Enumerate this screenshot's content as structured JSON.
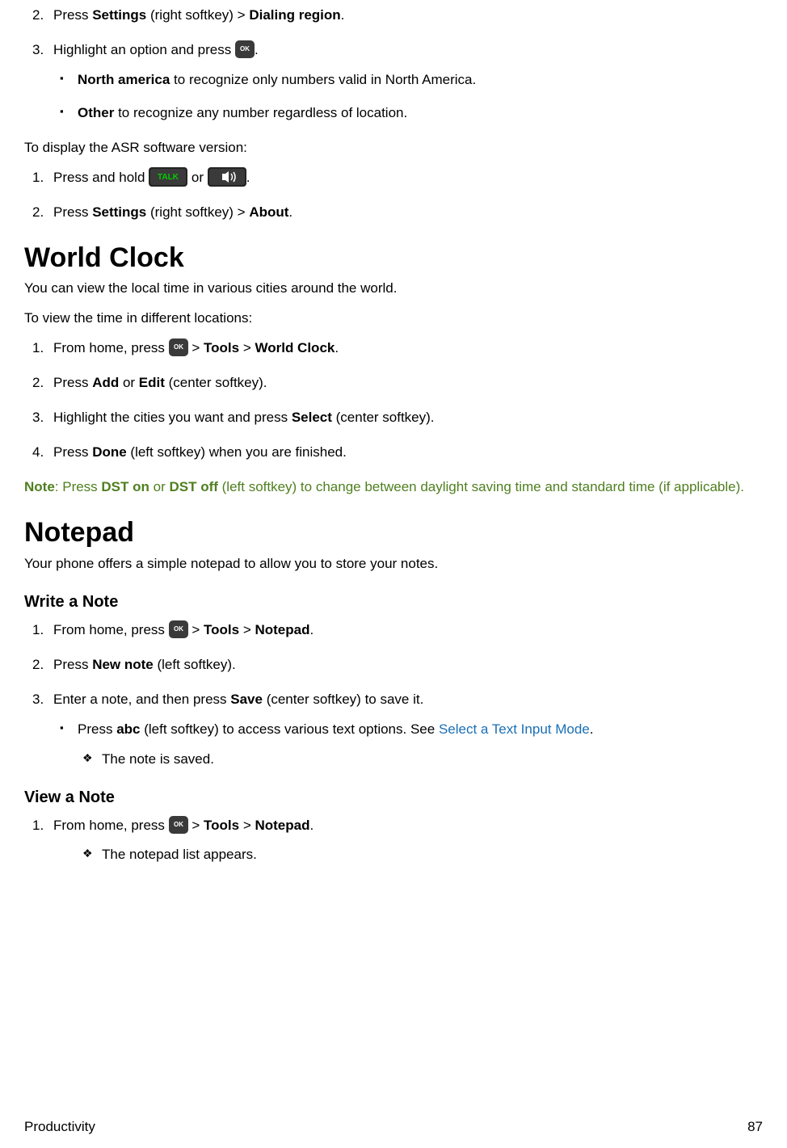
{
  "steps_top": {
    "s2_a": "Press ",
    "s2_b": "Settings",
    "s2_c": " (right softkey) > ",
    "s2_d": "Dialing region",
    "s2_e": ".",
    "s3_a": "Highlight an option and press ",
    "s3_b": ".",
    "bul1_a": "North america",
    "bul1_b": " to recognize only numbers valid in North America.",
    "bul2_a": "Other",
    "bul2_b": " to recognize any number regardless of location."
  },
  "asr": {
    "intro": "To display the ASR software version:",
    "s1_a": "Press and hold ",
    "s1_b": " or ",
    "s1_c": ".",
    "s2_a": "Press ",
    "s2_b": "Settings",
    "s2_c": " (right softkey) > ",
    "s2_d": "About",
    "s2_e": "."
  },
  "worldclock": {
    "title": "World Clock",
    "intro": "You can view the local time in various cities around the world.",
    "lead": "To view the time in different locations:",
    "s1_a": "From home, press ",
    "s1_b": " > ",
    "s1_c": "Tools",
    "s1_d": " > ",
    "s1_e": "World Clock",
    "s1_f": ".",
    "s2_a": "Press ",
    "s2_b": "Add",
    "s2_c": " or ",
    "s2_d": "Edit",
    "s2_e": " (center softkey).",
    "s3_a": "Highlight the cities you want and press ",
    "s3_b": "Select",
    "s3_c": " (center softkey).",
    "s4_a": "Press ",
    "s4_b": "Done",
    "s4_c": " (left softkey) when you are finished."
  },
  "note": {
    "a": "Note",
    "b": ": Press ",
    "c": "DST on",
    "d": " or ",
    "e": "DST off",
    "f": " (left softkey) to change between daylight saving time and standard time (if applicable)."
  },
  "notepad": {
    "title": "Notepad",
    "intro": "Your phone offers a simple notepad to allow you to store your notes.",
    "write_h": "Write a Note",
    "w1_a": "From home, press ",
    "w1_b": " > ",
    "w1_c": "Tools",
    "w1_d": " > ",
    "w1_e": "Notepad",
    "w1_f": ".",
    "w2_a": "Press ",
    "w2_b": "New note",
    "w2_c": " (left softkey).",
    "w3_a": "Enter a note, and then press ",
    "w3_b": "Save",
    "w3_c": " (center softkey) to save it.",
    "wb1_a": "Press ",
    "wb1_b": "abc",
    "wb1_c": " (left softkey) to access various text options. See ",
    "wb1_link": "Select a Text Input Mode",
    "wb1_d": ".",
    "wd1": "The note is saved.",
    "view_h": "View a Note",
    "v1_a": "From home, press ",
    "v1_b": " > ",
    "v1_c": "Tools",
    "v1_d": " > ",
    "v1_e": "Notepad",
    "v1_f": ".",
    "vd1": "The notepad list appears."
  },
  "footer": {
    "left": "Productivity",
    "right": "87"
  }
}
